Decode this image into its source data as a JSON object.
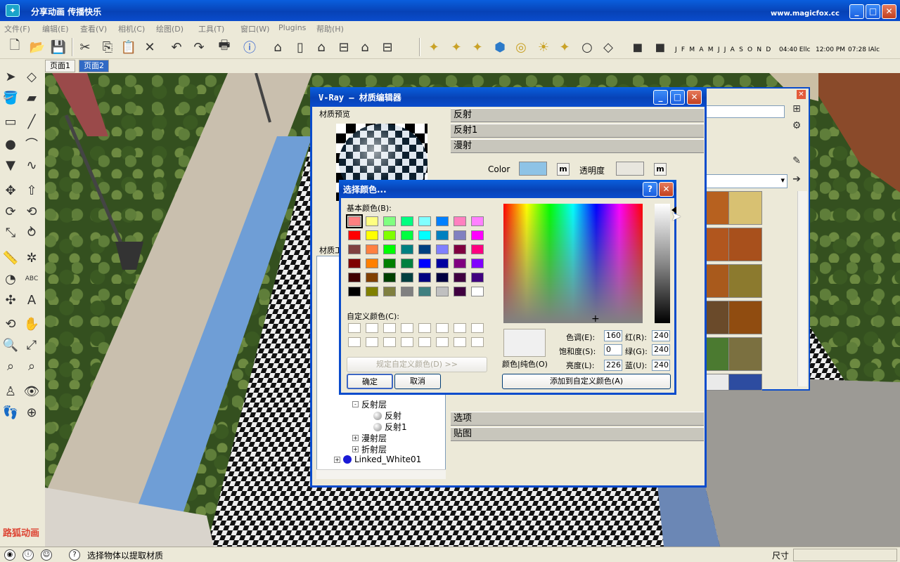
{
  "app": {
    "title": "分享动画  传播快乐",
    "site": "www.magicfox.cc",
    "buttons": {
      "minimize": "_",
      "maximize": "□",
      "close": "✕"
    }
  },
  "menu": [
    "文件(F)",
    "编辑(E)",
    "查看(V)",
    "相机(C)",
    "绘图(D)",
    "工具(T)",
    "窗口(W)",
    "Plugins",
    "帮助(H)"
  ],
  "toolbar": {
    "months": "J F M A M J J A S O N D",
    "time1": "04:40 Ellc",
    "time2": "12:00 PM",
    "time3": "07:28 IAlc"
  },
  "pages": {
    "page1": "页面1",
    "page2": "页面2"
  },
  "vray": {
    "title": "V-Ray — 材质编辑器",
    "preview_label": "材质预览",
    "sections": {
      "reflect": "反射",
      "reflect1": "反射1",
      "diffuse": "漫射",
      "options": "选项",
      "maps": "贴图"
    },
    "color_label": "Color",
    "opacity_label": "透明度",
    "m_button": "m",
    "tree_label": "材质工",
    "tree": {
      "reflect_layer": "反射层",
      "reflect": "反射",
      "reflect1": "反射1",
      "diffuse_layer": "漫射层",
      "refract_layer": "折射层",
      "linked": "Linked_White01"
    },
    "colors": {
      "diffuse_swatch": "#8ec3e6",
      "opacity_swatch": "#e8e6de"
    }
  },
  "picker": {
    "title": "选择颜色...",
    "help": "?",
    "basic_colors_label": "基本颜色(B):",
    "custom_colors_label": "自定义颜色(C):",
    "define_custom": "规定自定义颜色(D) >>",
    "ok": "确定",
    "cancel": "取消",
    "color_solid_label": "颜色|纯色(O)",
    "hue_label": "色调(E):",
    "sat_label": "饱和度(S):",
    "lum_label": "亮度(L):",
    "red_label": "红(R):",
    "green_label": "绿(G):",
    "blue_label": "蓝(U):",
    "hue": "160",
    "sat": "0",
    "lum": "226",
    "red": "240",
    "green": "240",
    "blue": "240",
    "add_custom": "添加到自定义颜色(A)",
    "basic_colors": [
      "#ff8080",
      "#ffff80",
      "#80ff80",
      "#00ff80",
      "#80ffff",
      "#0080ff",
      "#ff80c0",
      "#ff80ff",
      "#ff0000",
      "#ffff00",
      "#80ff00",
      "#00ff40",
      "#00ffff",
      "#0080c0",
      "#8080c0",
      "#ff00ff",
      "#804040",
      "#ff8040",
      "#00ff00",
      "#008080",
      "#004080",
      "#8080ff",
      "#800040",
      "#ff0080",
      "#800000",
      "#ff8000",
      "#008000",
      "#008040",
      "#0000ff",
      "#0000a0",
      "#800080",
      "#8000ff",
      "#400000",
      "#804000",
      "#004000",
      "#004040",
      "#000080",
      "#000040",
      "#400040",
      "#400080",
      "#000000",
      "#808000",
      "#808040",
      "#808080",
      "#408080",
      "#c0c0c0",
      "#400040",
      "#ffffff"
    ]
  },
  "status": {
    "hint": "选择物体以提取材质",
    "measure_label": "尺寸",
    "help_icon": "?"
  },
  "watermark": "路狐动画"
}
